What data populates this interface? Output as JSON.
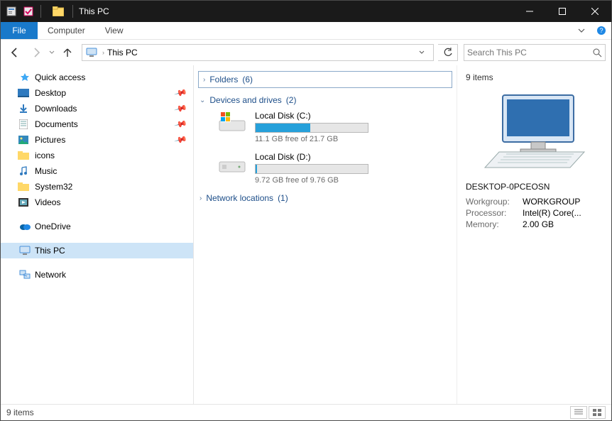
{
  "title": "This PC",
  "ribbon": {
    "file": "File",
    "tabs": [
      "Computer",
      "View"
    ]
  },
  "address": {
    "crumb": "This PC"
  },
  "search": {
    "placeholder": "Search This PC"
  },
  "sidebar": {
    "quick_access": "Quick access",
    "pinned": [
      {
        "label": "Desktop"
      },
      {
        "label": "Downloads"
      },
      {
        "label": "Documents"
      },
      {
        "label": "Pictures"
      }
    ],
    "recent": [
      {
        "label": "icons"
      },
      {
        "label": "Music"
      },
      {
        "label": "System32"
      },
      {
        "label": "Videos"
      }
    ],
    "onedrive": "OneDrive",
    "this_pc": "This PC",
    "network": "Network"
  },
  "groups": {
    "folders": {
      "label": "Folders",
      "count": "(6)"
    },
    "devices": {
      "label": "Devices and drives",
      "count": "(2)"
    },
    "network": {
      "label": "Network locations",
      "count": "(1)"
    }
  },
  "drives": [
    {
      "name": "Local Disk (C:)",
      "free_text": "11.1 GB free of 21.7 GB",
      "used_pct": 49
    },
    {
      "name": "Local Disk (D:)",
      "free_text": "9.72 GB free of 9.76 GB",
      "used_pct": 1
    }
  ],
  "details": {
    "count_label": "9 items",
    "computer_name": "DESKTOP-0PCEOSN",
    "rows": [
      {
        "k": "Workgroup:",
        "v": "WORKGROUP"
      },
      {
        "k": "Processor:",
        "v": "Intel(R) Core(..."
      },
      {
        "k": "Memory:",
        "v": "2.00 GB"
      }
    ]
  },
  "status": {
    "left": "9 items"
  }
}
